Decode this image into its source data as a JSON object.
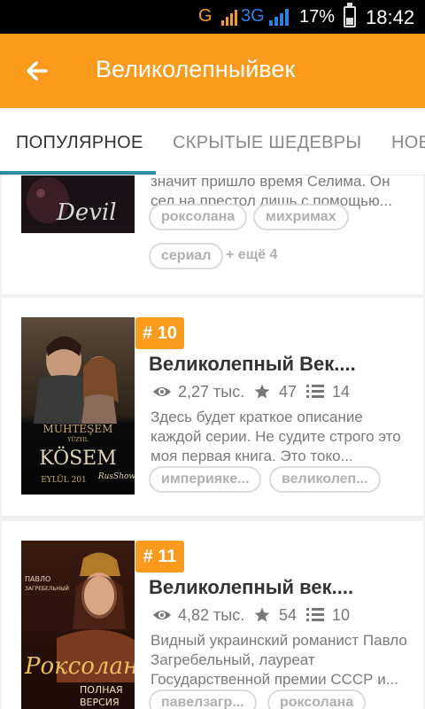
{
  "status_bar": {
    "network_g": "G",
    "network_3g": "3G",
    "battery_percent": "17%",
    "time": "18:42"
  },
  "app_bar": {
    "back_icon": "arrow-left-icon",
    "title": "Великолепныйвек"
  },
  "tabs": [
    {
      "label": "ПОПУЛЯРНОЕ",
      "active": true
    },
    {
      "label": "СКРЫТЫЕ ШЕДЕВРЫ",
      "active": false
    },
    {
      "label": "НОВ",
      "active": false
    }
  ],
  "cards": [
    {
      "description": "значит пришло время Селима. Он сел на престол лишь с помощью...",
      "tags": [
        "роксолана",
        "михримах",
        "сериал"
      ],
      "more_tags": "+ ещё 4"
    },
    {
      "rank": "# 10",
      "title": "Великолепный Век....",
      "views": "2,27 тыс.",
      "stars": "47",
      "chapters": "14",
      "description": "Здесь будет краткое описание каждой серии. Не судите строго это моя первая книга. Это токо...",
      "tags": [
        "империяке...",
        "великолеп..."
      ],
      "cover_text": {
        "line1": "MUHTEŞEM",
        "line2": "YÜZYIL",
        "line3": "KÖSEM",
        "line4": "EYLÜL 201",
        "line5": "RusShow"
      }
    },
    {
      "rank": "# 11",
      "title": "Великолепный век....",
      "views": "4,82 тыс.",
      "stars": "54",
      "chapters": "10",
      "description": "Видный украинский романист Павло Загребельный, лауреат Государственной премии СССР и...",
      "tags": [
        "павелзагр...",
        "роксолана"
      ],
      "cover_text": {
        "line1": "ПАВЛО",
        "line2": "ЗАГРЕБЕЛЬНЫЙ",
        "line3": "Роксолана",
        "line4": "ПОЛНАЯ",
        "line5": "ВЕРСИЯ"
      }
    }
  ]
}
